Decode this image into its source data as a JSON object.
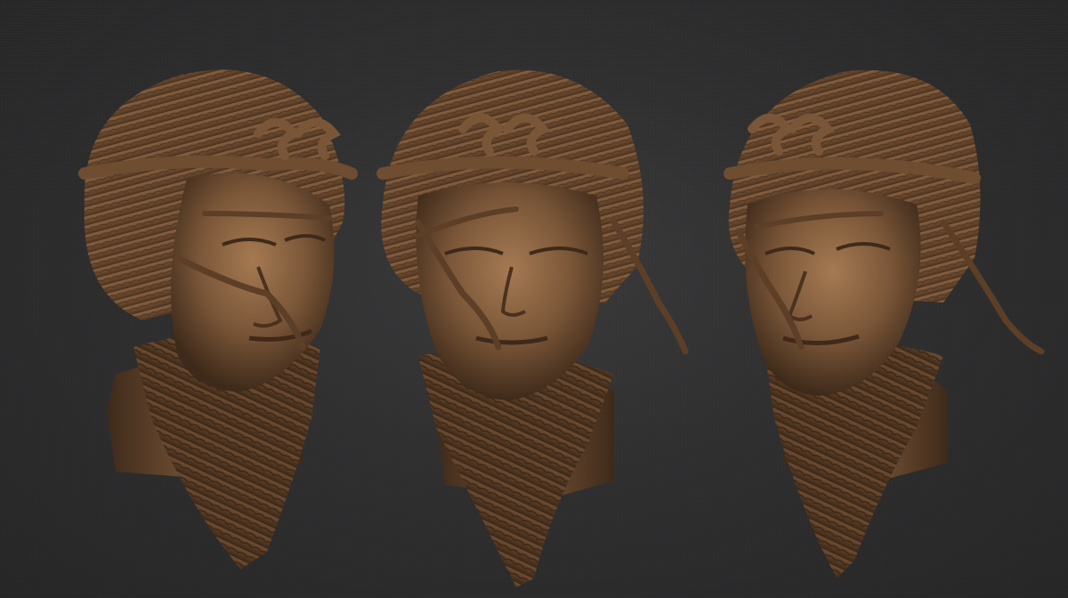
{
  "scene": {
    "subject": "sculpt",
    "views": [
      {
        "id": "left-three-quarter"
      },
      {
        "id": "front"
      },
      {
        "id": "right-three-quarter"
      }
    ],
    "colors": {
      "background": "#2e2e2f",
      "clay_base": "#7a5638",
      "clay_light": "#a57a52",
      "clay_dark": "#3e2a1a"
    }
  }
}
